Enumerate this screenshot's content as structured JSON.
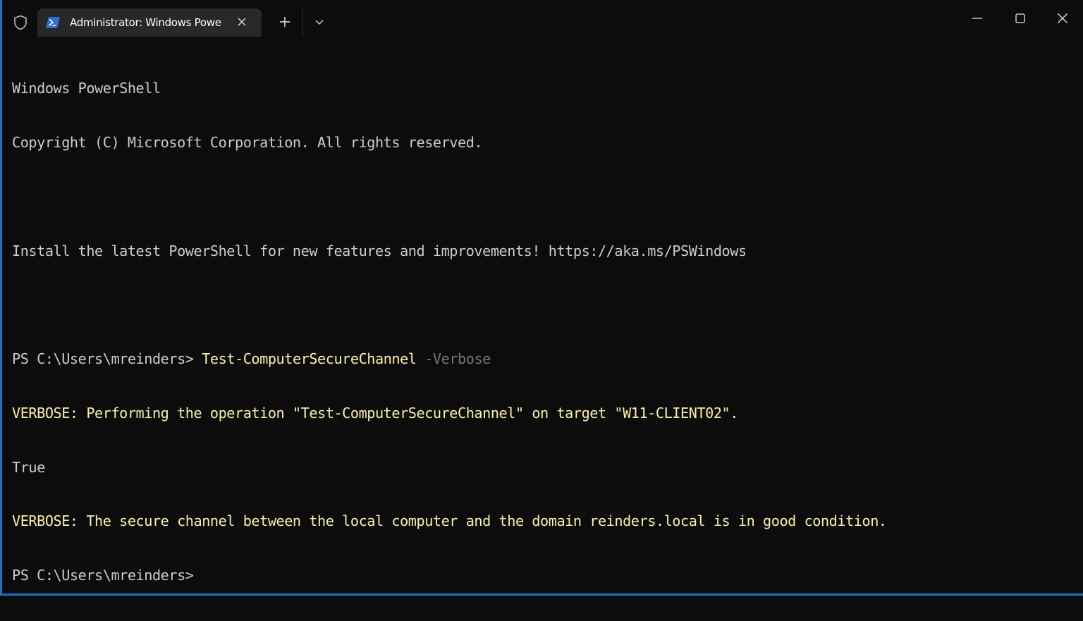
{
  "titlebar": {
    "tab_title": "Administrator: Windows Powe",
    "icons": {
      "shield": "shield-icon",
      "tab": "powershell-icon",
      "close_tab": "close-icon",
      "new_tab": "plus-icon",
      "dropdown": "chevron-down-icon",
      "minimize": "minimize-icon",
      "maximize": "maximize-icon",
      "close_window": "close-icon"
    }
  },
  "colors": {
    "background": "#0c0c0c",
    "foreground": "#cccccc",
    "command": "#f9f1a5",
    "parameter": "#767676",
    "verbose": "#f9f1a5",
    "accent_border": "#1f6fc5",
    "tab_background": "#282828"
  },
  "terminal": {
    "header_line1": "Windows PowerShell",
    "header_line2": "Copyright (C) Microsoft Corporation. All rights reserved.",
    "install_line": "Install the latest PowerShell for new features and improvements! https://aka.ms/PSWindows",
    "prompt1": "PS C:\\Users\\mreinders> ",
    "command": "Test-ComputerSecureChannel",
    "parameter": " -Verbose",
    "verbose1": "VERBOSE: Performing the operation \"Test-ComputerSecureChannel\" on target \"W11-CLIENT02\".",
    "result": "True",
    "verbose2": "VERBOSE: The secure channel between the local computer and the domain reinders.local is in good condition.",
    "prompt2": "PS C:\\Users\\mreinders>"
  }
}
